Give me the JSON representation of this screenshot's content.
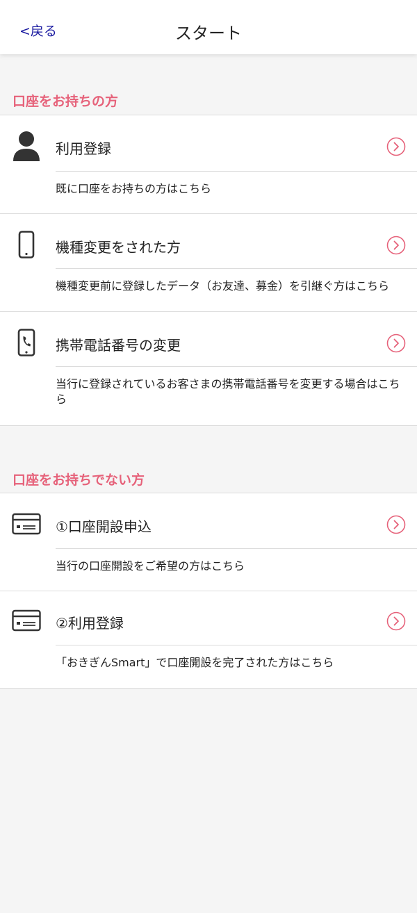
{
  "header": {
    "back_label": "<戻る",
    "title": "スタート"
  },
  "sections": [
    {
      "title": "口座をお持ちの方",
      "items": [
        {
          "icon": "person-icon",
          "title": "利用登録",
          "description": "既に口座をお持ちの方はこちら"
        },
        {
          "icon": "smartphone-icon",
          "title": "機種変更をされた方",
          "description": "機種変更前に登録したデータ（お友達、募金）を引継ぐ方はこちら"
        },
        {
          "icon": "phone-call-icon",
          "title": "携帯電話番号の変更",
          "description": "当行に登録されているお客さまの携帯電話番号を変更する場合はこちら"
        }
      ]
    },
    {
      "title": "口座をお持ちでない方",
      "items": [
        {
          "icon": "card-icon",
          "title": "①口座開設申込",
          "description": "当行の口座開設をご希望の方はこちら"
        },
        {
          "icon": "card-icon",
          "title": "②利用登録",
          "description": "「おきぎんSmart」で口座開設を完了された方はこちら"
        }
      ]
    }
  ],
  "colors": {
    "accent": "#e6627a",
    "link": "#1a1aa0",
    "background": "#f5f5f5",
    "divider": "#dcdcdc"
  }
}
